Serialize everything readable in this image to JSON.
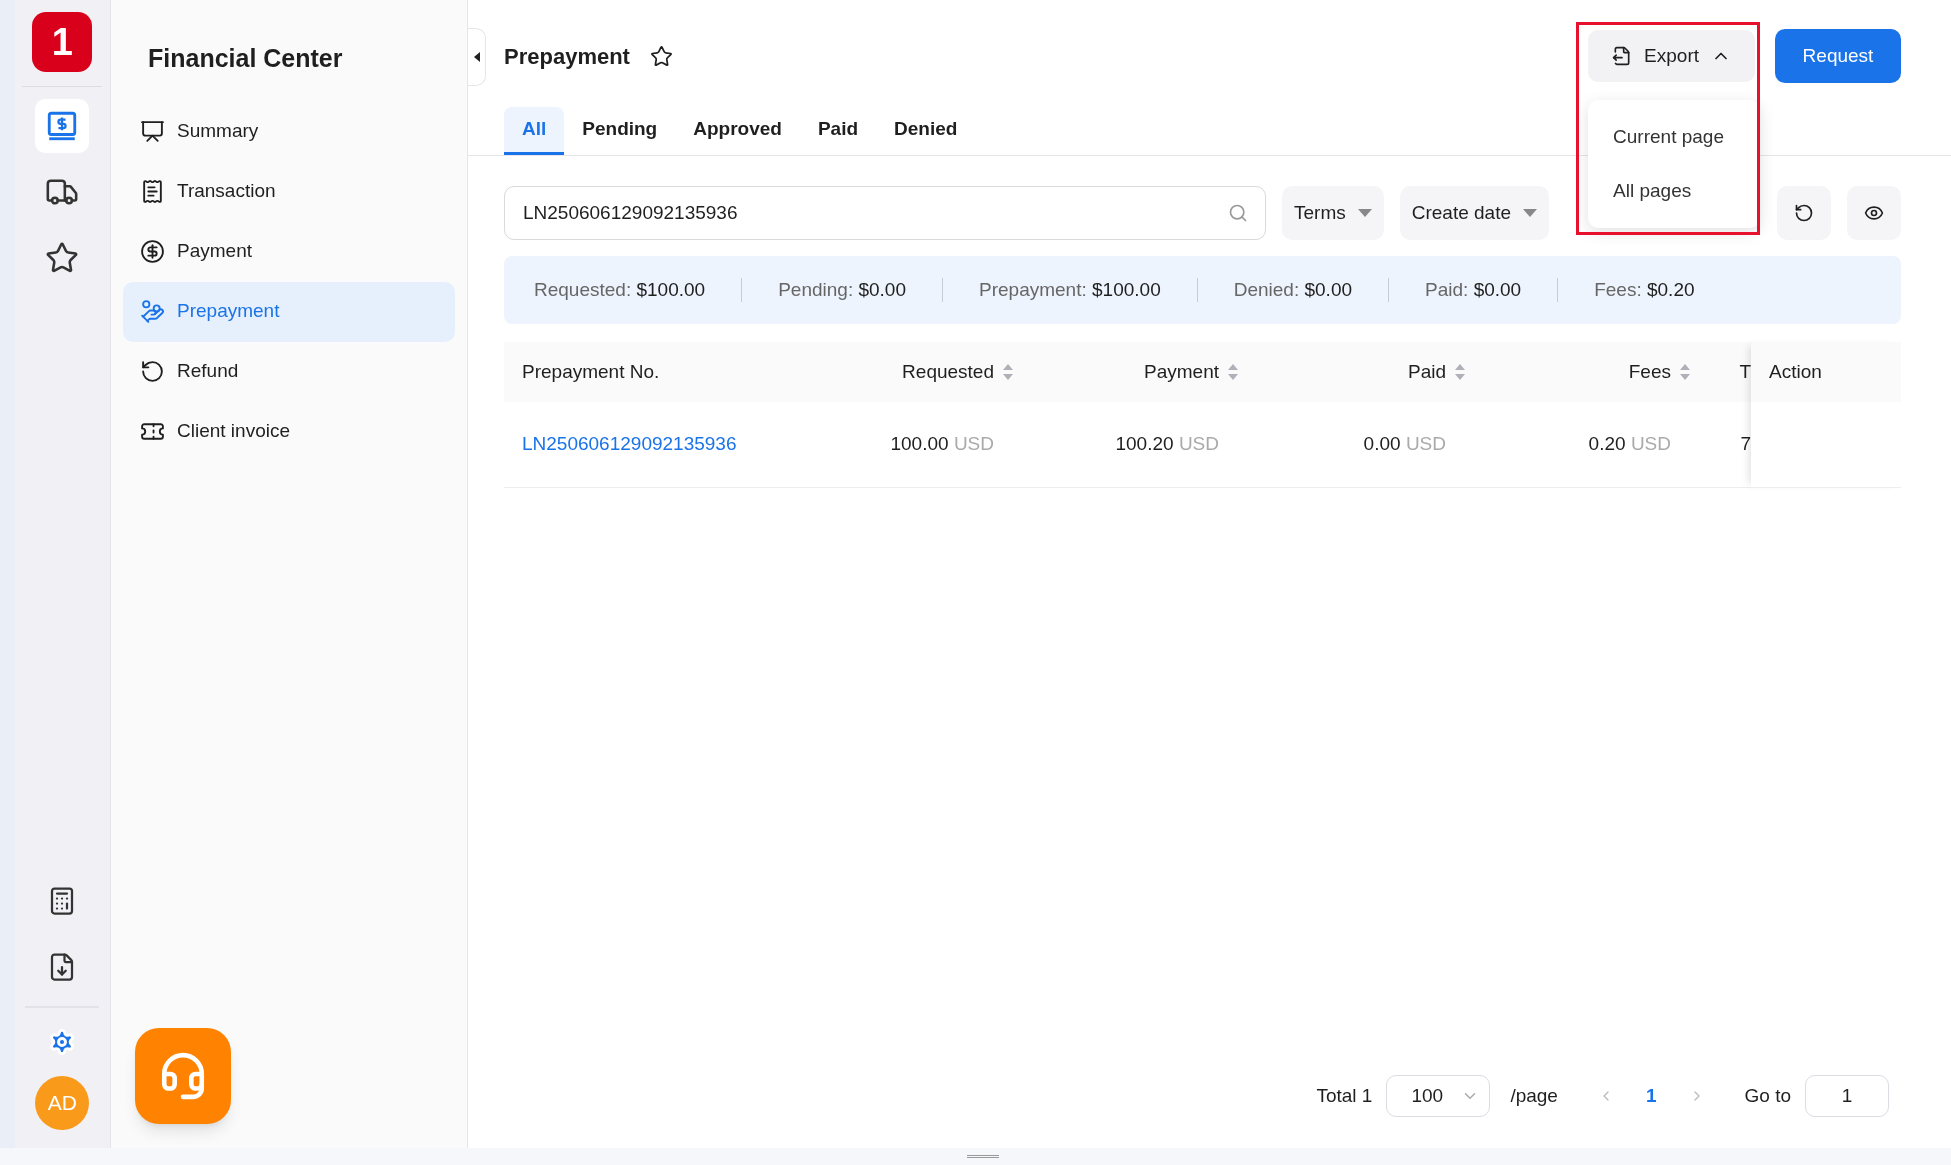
{
  "rail": {
    "logo": "1",
    "items": [
      {
        "kind": "finance",
        "selected": true
      },
      {
        "kind": "truck",
        "selected": false
      },
      {
        "kind": "star",
        "selected": false
      }
    ],
    "bottom_items": [
      {
        "kind": "calculator"
      },
      {
        "kind": "download"
      }
    ],
    "settings": {
      "kind": "gear"
    },
    "avatar": "AD"
  },
  "sidebar": {
    "title": "Financial Center",
    "items": [
      {
        "label": "Summary",
        "kind": "chart",
        "selected": false
      },
      {
        "label": "Transaction",
        "kind": "receipt",
        "selected": false
      },
      {
        "label": "Payment",
        "kind": "coin",
        "selected": false
      },
      {
        "label": "Prepayment",
        "kind": "hand",
        "selected": true
      },
      {
        "label": "Refund",
        "kind": "refund",
        "selected": false
      },
      {
        "label": "Client invoice",
        "kind": "ticket",
        "selected": false
      }
    ]
  },
  "header": {
    "title": "Prepayment",
    "export": {
      "label": "Export",
      "expanded": true,
      "highlighted": true
    },
    "request": "Request"
  },
  "export_menu": [
    "Current page",
    "All pages"
  ],
  "tabs": [
    {
      "label": "All",
      "selected": true
    },
    {
      "label": "Pending",
      "selected": false
    },
    {
      "label": "Approved",
      "selected": false
    },
    {
      "label": "Paid",
      "selected": false
    },
    {
      "label": "Denied",
      "selected": false
    }
  ],
  "search": {
    "value": "LN250606129092135936"
  },
  "filters": [
    "Terms",
    "Create date"
  ],
  "summary": [
    {
      "label": "Requested:",
      "value": "$100.00"
    },
    {
      "label": "Pending:",
      "value": "$0.00"
    },
    {
      "label": "Prepayment:",
      "value": "$100.00"
    },
    {
      "label": "Denied:",
      "value": "$0.00"
    },
    {
      "label": "Paid:",
      "value": "$0.00"
    },
    {
      "label": "Fees:",
      "value": "$0.20"
    }
  ],
  "table": {
    "columns": [
      {
        "label": "Prepayment No.",
        "sortable": false
      },
      {
        "label": "Requested",
        "sortable": true
      },
      {
        "label": "Payment",
        "sortable": true
      },
      {
        "label": "Paid",
        "sortable": true
      },
      {
        "label": "Fees",
        "sortable": true
      },
      {
        "label": "T",
        "sortable": false
      },
      {
        "label": "Action",
        "sortable": false
      }
    ],
    "rows": [
      {
        "cells": [
          {
            "kind": "link",
            "text": "LN250606129092135936"
          },
          {
            "kind": "amount",
            "text": "100.00",
            "currency": "USD"
          },
          {
            "kind": "amount",
            "text": "100.20",
            "currency": "USD"
          },
          {
            "kind": "amount",
            "text": "0.00",
            "currency": "USD"
          },
          {
            "kind": "amount",
            "text": "0.20",
            "currency": "USD"
          },
          {
            "kind": "text",
            "text": "7"
          }
        ]
      }
    ]
  },
  "pagination": {
    "total": "Total 1",
    "page_size": "100",
    "per_page": "/page",
    "current": "1",
    "goto_label": "Go to",
    "goto_value": "1"
  }
}
